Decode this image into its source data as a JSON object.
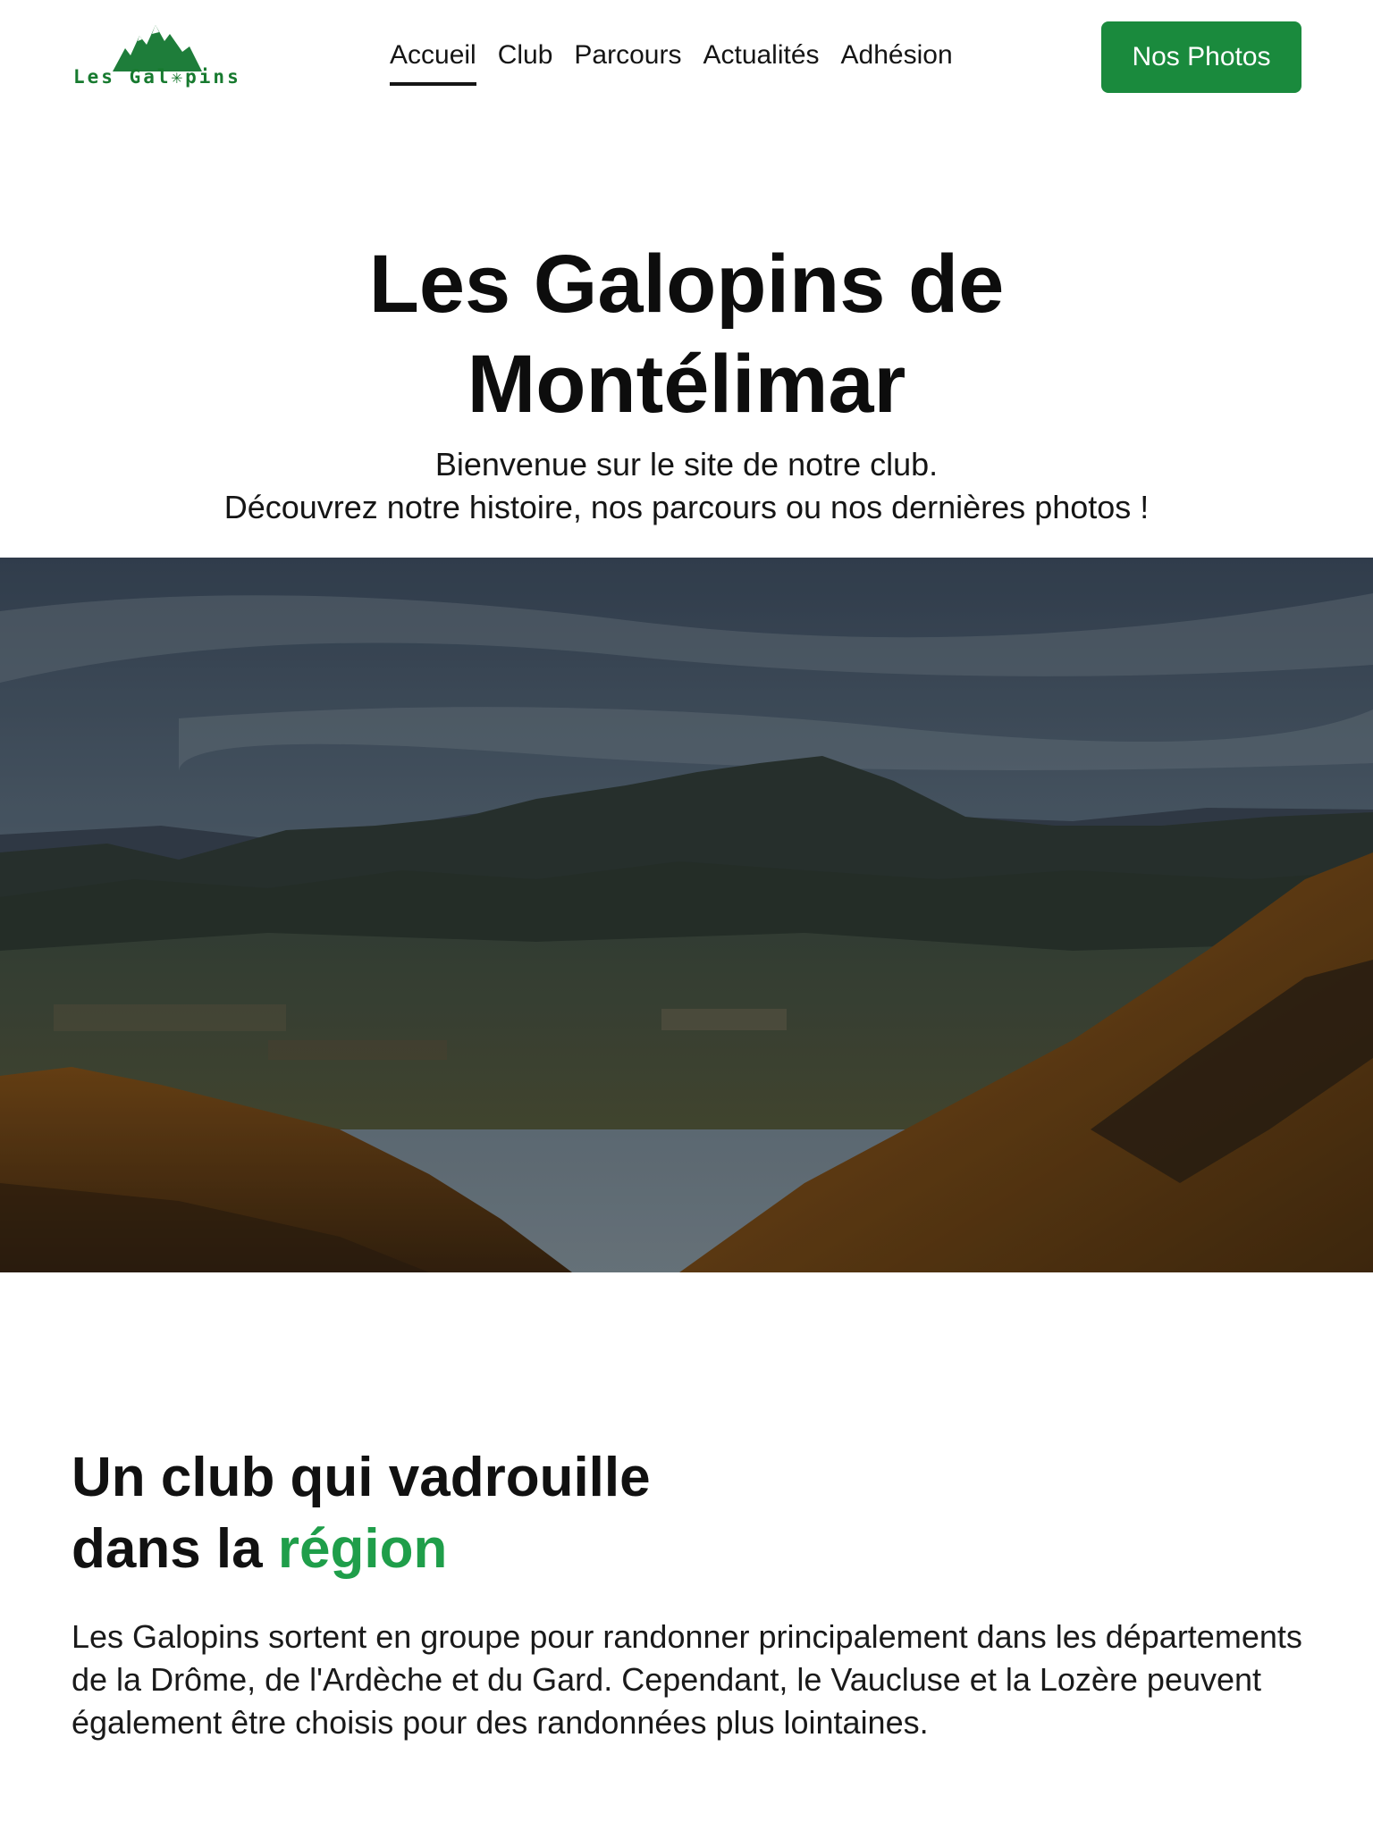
{
  "header": {
    "logo_text": "Les Gal✳pins",
    "nav": [
      {
        "label": "Accueil",
        "active": true
      },
      {
        "label": "Club",
        "active": false
      },
      {
        "label": "Parcours",
        "active": false
      },
      {
        "label": "Actualités",
        "active": false
      },
      {
        "label": "Adhésion",
        "active": false
      }
    ],
    "cta_label": "Nos Photos"
  },
  "hero": {
    "title_line1": "Les Galopins de",
    "title_line2": "Montélimar",
    "subtitle_line1": "Bienvenue sur le site de notre club.",
    "subtitle_line2": "Découvrez notre histoire, nos parcours ou nos dernières photos !"
  },
  "club": {
    "heading_line1": "Un club qui vadrouille",
    "heading_line2_prefix": "dans la ",
    "heading_line2_accent": "région",
    "paragraph": "Les Galopins sortent en groupe pour randonner principalement dans les départements de la Drôme, de l'Ardèche et du Gard. Cependant, le Vaucluse et la Lozère peuvent également être choisis pour des randonnées plus lointaines."
  },
  "colors": {
    "brand_green": "#1a8a3d",
    "accent_green": "#1f9e4a",
    "logo_green": "#177a2f",
    "text": "#111111",
    "background": "#ffffff"
  }
}
